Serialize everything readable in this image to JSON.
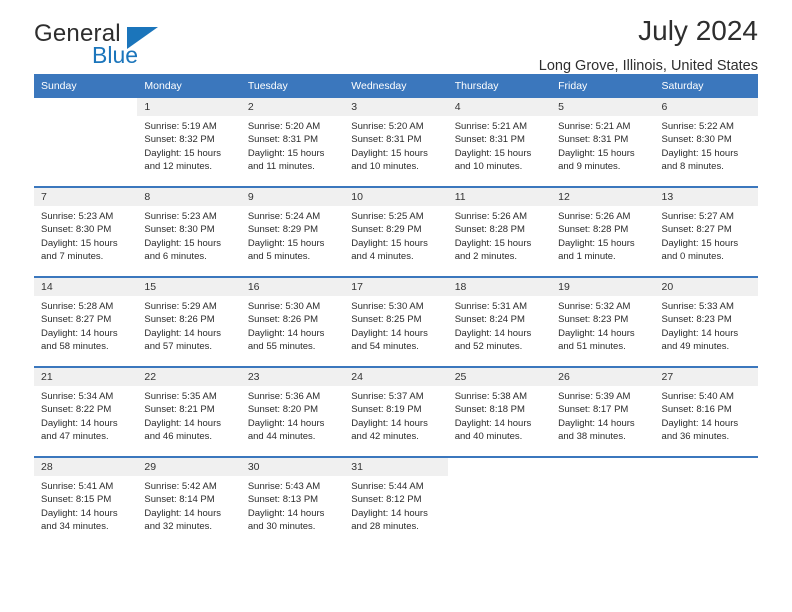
{
  "brand": {
    "name_top": "General",
    "name_bottom": "Blue",
    "triangle_color": "#1b75bb"
  },
  "header": {
    "title": "July 2024",
    "subtitle": "Long Grove, Illinois, United States"
  },
  "theme": {
    "header_blue": "#3b77bd",
    "daynum_bg": "#f0f0f0",
    "text": "#2b2b2b"
  },
  "labels": {
    "sunrise_prefix": "Sunrise: ",
    "sunset_prefix": "Sunset: ",
    "daylight_prefix": "Daylight: "
  },
  "weekday_headers": [
    "Sunday",
    "Monday",
    "Tuesday",
    "Wednesday",
    "Thursday",
    "Friday",
    "Saturday"
  ],
  "weeks": [
    [
      {
        "day": "",
        "blank": true
      },
      {
        "day": "1",
        "sunrise": "Sunrise: 5:19 AM",
        "sunset": "Sunset: 8:32 PM",
        "daylight1": "Daylight: 15 hours",
        "daylight2": "and 12 minutes."
      },
      {
        "day": "2",
        "sunrise": "Sunrise: 5:20 AM",
        "sunset": "Sunset: 8:31 PM",
        "daylight1": "Daylight: 15 hours",
        "daylight2": "and 11 minutes."
      },
      {
        "day": "3",
        "sunrise": "Sunrise: 5:20 AM",
        "sunset": "Sunset: 8:31 PM",
        "daylight1": "Daylight: 15 hours",
        "daylight2": "and 10 minutes."
      },
      {
        "day": "4",
        "sunrise": "Sunrise: 5:21 AM",
        "sunset": "Sunset: 8:31 PM",
        "daylight1": "Daylight: 15 hours",
        "daylight2": "and 10 minutes."
      },
      {
        "day": "5",
        "sunrise": "Sunrise: 5:21 AM",
        "sunset": "Sunset: 8:31 PM",
        "daylight1": "Daylight: 15 hours",
        "daylight2": "and 9 minutes."
      },
      {
        "day": "6",
        "sunrise": "Sunrise: 5:22 AM",
        "sunset": "Sunset: 8:30 PM",
        "daylight1": "Daylight: 15 hours",
        "daylight2": "and 8 minutes."
      }
    ],
    [
      {
        "day": "7",
        "sunrise": "Sunrise: 5:23 AM",
        "sunset": "Sunset: 8:30 PM",
        "daylight1": "Daylight: 15 hours",
        "daylight2": "and 7 minutes."
      },
      {
        "day": "8",
        "sunrise": "Sunrise: 5:23 AM",
        "sunset": "Sunset: 8:30 PM",
        "daylight1": "Daylight: 15 hours",
        "daylight2": "and 6 minutes."
      },
      {
        "day": "9",
        "sunrise": "Sunrise: 5:24 AM",
        "sunset": "Sunset: 8:29 PM",
        "daylight1": "Daylight: 15 hours",
        "daylight2": "and 5 minutes."
      },
      {
        "day": "10",
        "sunrise": "Sunrise: 5:25 AM",
        "sunset": "Sunset: 8:29 PM",
        "daylight1": "Daylight: 15 hours",
        "daylight2": "and 4 minutes."
      },
      {
        "day": "11",
        "sunrise": "Sunrise: 5:26 AM",
        "sunset": "Sunset: 8:28 PM",
        "daylight1": "Daylight: 15 hours",
        "daylight2": "and 2 minutes."
      },
      {
        "day": "12",
        "sunrise": "Sunrise: 5:26 AM",
        "sunset": "Sunset: 8:28 PM",
        "daylight1": "Daylight: 15 hours",
        "daylight2": "and 1 minute."
      },
      {
        "day": "13",
        "sunrise": "Sunrise: 5:27 AM",
        "sunset": "Sunset: 8:27 PM",
        "daylight1": "Daylight: 15 hours",
        "daylight2": "and 0 minutes."
      }
    ],
    [
      {
        "day": "14",
        "sunrise": "Sunrise: 5:28 AM",
        "sunset": "Sunset: 8:27 PM",
        "daylight1": "Daylight: 14 hours",
        "daylight2": "and 58 minutes."
      },
      {
        "day": "15",
        "sunrise": "Sunrise: 5:29 AM",
        "sunset": "Sunset: 8:26 PM",
        "daylight1": "Daylight: 14 hours",
        "daylight2": "and 57 minutes."
      },
      {
        "day": "16",
        "sunrise": "Sunrise: 5:30 AM",
        "sunset": "Sunset: 8:26 PM",
        "daylight1": "Daylight: 14 hours",
        "daylight2": "and 55 minutes."
      },
      {
        "day": "17",
        "sunrise": "Sunrise: 5:30 AM",
        "sunset": "Sunset: 8:25 PM",
        "daylight1": "Daylight: 14 hours",
        "daylight2": "and 54 minutes."
      },
      {
        "day": "18",
        "sunrise": "Sunrise: 5:31 AM",
        "sunset": "Sunset: 8:24 PM",
        "daylight1": "Daylight: 14 hours",
        "daylight2": "and 52 minutes."
      },
      {
        "day": "19",
        "sunrise": "Sunrise: 5:32 AM",
        "sunset": "Sunset: 8:23 PM",
        "daylight1": "Daylight: 14 hours",
        "daylight2": "and 51 minutes."
      },
      {
        "day": "20",
        "sunrise": "Sunrise: 5:33 AM",
        "sunset": "Sunset: 8:23 PM",
        "daylight1": "Daylight: 14 hours",
        "daylight2": "and 49 minutes."
      }
    ],
    [
      {
        "day": "21",
        "sunrise": "Sunrise: 5:34 AM",
        "sunset": "Sunset: 8:22 PM",
        "daylight1": "Daylight: 14 hours",
        "daylight2": "and 47 minutes."
      },
      {
        "day": "22",
        "sunrise": "Sunrise: 5:35 AM",
        "sunset": "Sunset: 8:21 PM",
        "daylight1": "Daylight: 14 hours",
        "daylight2": "and 46 minutes."
      },
      {
        "day": "23",
        "sunrise": "Sunrise: 5:36 AM",
        "sunset": "Sunset: 8:20 PM",
        "daylight1": "Daylight: 14 hours",
        "daylight2": "and 44 minutes."
      },
      {
        "day": "24",
        "sunrise": "Sunrise: 5:37 AM",
        "sunset": "Sunset: 8:19 PM",
        "daylight1": "Daylight: 14 hours",
        "daylight2": "and 42 minutes."
      },
      {
        "day": "25",
        "sunrise": "Sunrise: 5:38 AM",
        "sunset": "Sunset: 8:18 PM",
        "daylight1": "Daylight: 14 hours",
        "daylight2": "and 40 minutes."
      },
      {
        "day": "26",
        "sunrise": "Sunrise: 5:39 AM",
        "sunset": "Sunset: 8:17 PM",
        "daylight1": "Daylight: 14 hours",
        "daylight2": "and 38 minutes."
      },
      {
        "day": "27",
        "sunrise": "Sunrise: 5:40 AM",
        "sunset": "Sunset: 8:16 PM",
        "daylight1": "Daylight: 14 hours",
        "daylight2": "and 36 minutes."
      }
    ],
    [
      {
        "day": "28",
        "sunrise": "Sunrise: 5:41 AM",
        "sunset": "Sunset: 8:15 PM",
        "daylight1": "Daylight: 14 hours",
        "daylight2": "and 34 minutes."
      },
      {
        "day": "29",
        "sunrise": "Sunrise: 5:42 AM",
        "sunset": "Sunset: 8:14 PM",
        "daylight1": "Daylight: 14 hours",
        "daylight2": "and 32 minutes."
      },
      {
        "day": "30",
        "sunrise": "Sunrise: 5:43 AM",
        "sunset": "Sunset: 8:13 PM",
        "daylight1": "Daylight: 14 hours",
        "daylight2": "and 30 minutes."
      },
      {
        "day": "31",
        "sunrise": "Sunrise: 5:44 AM",
        "sunset": "Sunset: 8:12 PM",
        "daylight1": "Daylight: 14 hours",
        "daylight2": "and 28 minutes."
      },
      {
        "day": "",
        "blank": true
      },
      {
        "day": "",
        "blank": true
      },
      {
        "day": "",
        "blank": true
      }
    ]
  ]
}
